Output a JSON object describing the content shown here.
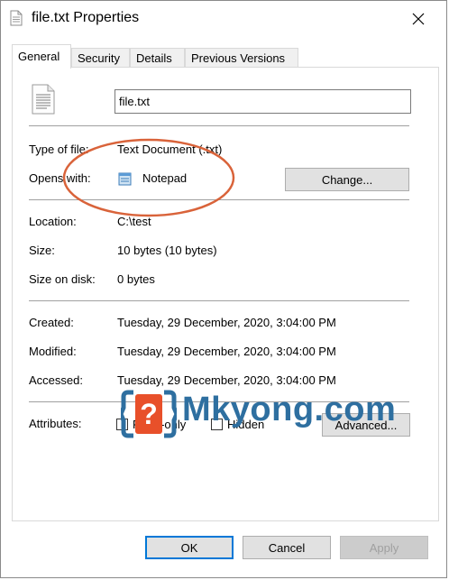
{
  "window": {
    "title": "file.txt Properties",
    "close_icon": "close-icon"
  },
  "tabs": [
    {
      "label": "General",
      "active": true
    },
    {
      "label": "Security",
      "active": false
    },
    {
      "label": "Details",
      "active": false
    },
    {
      "label": "Previous Versions",
      "active": false
    }
  ],
  "general": {
    "file_name": "file.txt",
    "type_label": "Type of file:",
    "type_value": "Text Document (.txt)",
    "opens_label": "Opens with:",
    "opens_value": "Notepad",
    "change_button": "Change...",
    "location_label": "Location:",
    "location_value": "C:\\test",
    "size_label": "Size:",
    "size_value": "10 bytes (10 bytes)",
    "size_on_disk_label": "Size on disk:",
    "size_on_disk_value": "0 bytes",
    "created_label": "Created:",
    "created_value": "Tuesday, 29 December, 2020, 3:04:00 PM",
    "modified_label": "Modified:",
    "modified_value": "Tuesday, 29 December, 2020, 3:04:00 PM",
    "accessed_label": "Accessed:",
    "accessed_value": "Tuesday, 29 December, 2020, 3:04:00 PM",
    "attributes_label": "Attributes:",
    "readonly_label": "Read-only",
    "readonly_checked": false,
    "hidden_label": "Hidden",
    "hidden_checked": false,
    "advanced_button": "Advanced..."
  },
  "watermark": {
    "text": "Mkyong.com",
    "icon": "question-mark-icon",
    "color": "#2e6fa0",
    "accent": "#e8502a"
  },
  "annotation": {
    "color": "#d9633a"
  },
  "footer": {
    "ok": "OK",
    "cancel": "Cancel",
    "apply": "Apply"
  }
}
